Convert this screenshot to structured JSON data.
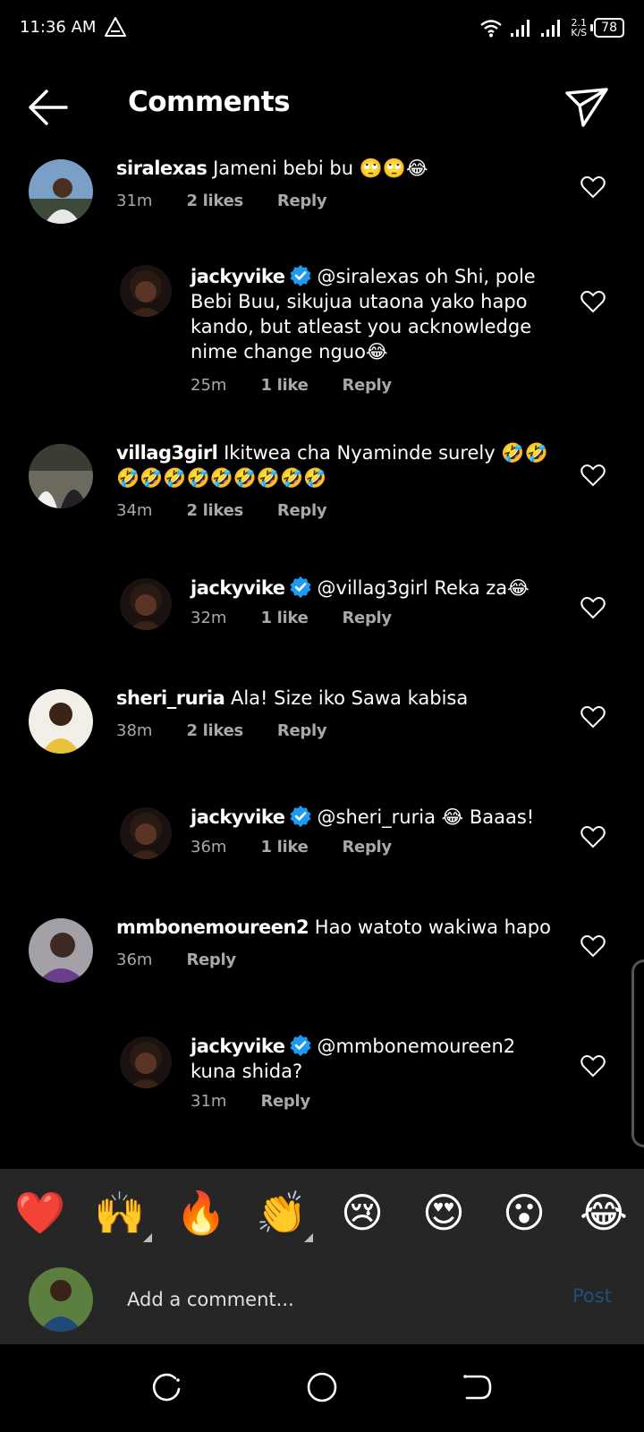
{
  "status_bar": {
    "time": "11:36 AM",
    "net_speed_value": "2.1",
    "net_speed_unit": "K/S",
    "battery": "78",
    "icons": [
      "warning-icon",
      "wifi-icon",
      "signal-icon",
      "signal-icon"
    ]
  },
  "header": {
    "title": "Comments",
    "back_icon": "arrow-left-icon",
    "share_icon": "send-icon"
  },
  "comments": [
    {
      "username": "siralexas",
      "verified": false,
      "text": "Jameni bebi bu 🙄🙄😂",
      "time": "31m",
      "likes": "2 likes",
      "reply": "Reply",
      "avatar_colors": [
        "#7ba0c8",
        "#3d4a3a"
      ]
    },
    {
      "username": "jackyvike",
      "verified": true,
      "mention": "@siralexas",
      "text": "oh Shi, pole Bebi Buu, sikujua utaona yako hapo kando, but atleast you acknowledge nime change nguo😂",
      "time": "25m",
      "likes": "1 like",
      "reply": "Reply",
      "avatar_colors": [
        "#5a3525",
        "#1a1210"
      ]
    },
    {
      "username": "villag3girl",
      "verified": false,
      "text": "Ikitwea cha Nyaminde surely 🤣🤣🤣🤣🤣🤣🤣🤣🤣🤣🤣",
      "time": "34m",
      "likes": "2 likes",
      "reply": "Reply",
      "avatar_colors": [
        "#6d6a60",
        "#222"
      ]
    },
    {
      "username": "jackyvike",
      "verified": true,
      "mention": "@villag3girl",
      "text": "Reka za😂",
      "time": "32m",
      "likes": "1 like",
      "reply": "Reply",
      "avatar_colors": [
        "#5a3525",
        "#1a1210"
      ]
    },
    {
      "username": "sheri_ruria",
      "verified": false,
      "text": "Ala! Size iko Sawa kabisa",
      "time": "38m",
      "likes": "2 likes",
      "reply": "Reply",
      "avatar_colors": [
        "#f2eee8",
        "#e8c23a"
      ]
    },
    {
      "username": "jackyvike",
      "verified": true,
      "mention": "@sheri_ruria",
      "text": "😂 Baaas!",
      "time": "36m",
      "likes": "1 like",
      "reply": "Reply",
      "avatar_colors": [
        "#5a3525",
        "#1a1210"
      ]
    },
    {
      "username": "mmbonemoureen2",
      "verified": false,
      "text": "Hao watoto wakiwa hapo",
      "time": "36m",
      "likes": "",
      "reply": "Reply",
      "avatar_colors": [
        "#a4a0a8",
        "#6a3e8a"
      ]
    },
    {
      "username": "jackyvike",
      "verified": true,
      "mention": "@mmbonemoureen2",
      "text": "kuna shida?",
      "time": "31m",
      "likes": "",
      "reply": "Reply",
      "avatar_colors": [
        "#5a3525",
        "#1a1210"
      ]
    }
  ],
  "reactions": [
    "❤️",
    "🙌",
    "🔥",
    "👏",
    "😢",
    "😍",
    "😮",
    "😂"
  ],
  "composer": {
    "placeholder": "Add a comment...",
    "post_label": "Post",
    "avatar_colors": [
      "#5c7e3e",
      "#1f4a78"
    ]
  },
  "nav_bar": {
    "buttons": [
      "recents-icon",
      "home-icon",
      "back-icon"
    ]
  },
  "colors": {
    "background": "#000000",
    "meta_text": "#a8a8a8",
    "panel": "#262626",
    "verified_blue": "#1d9bf0",
    "post_disabled": "#1f4f7f"
  }
}
